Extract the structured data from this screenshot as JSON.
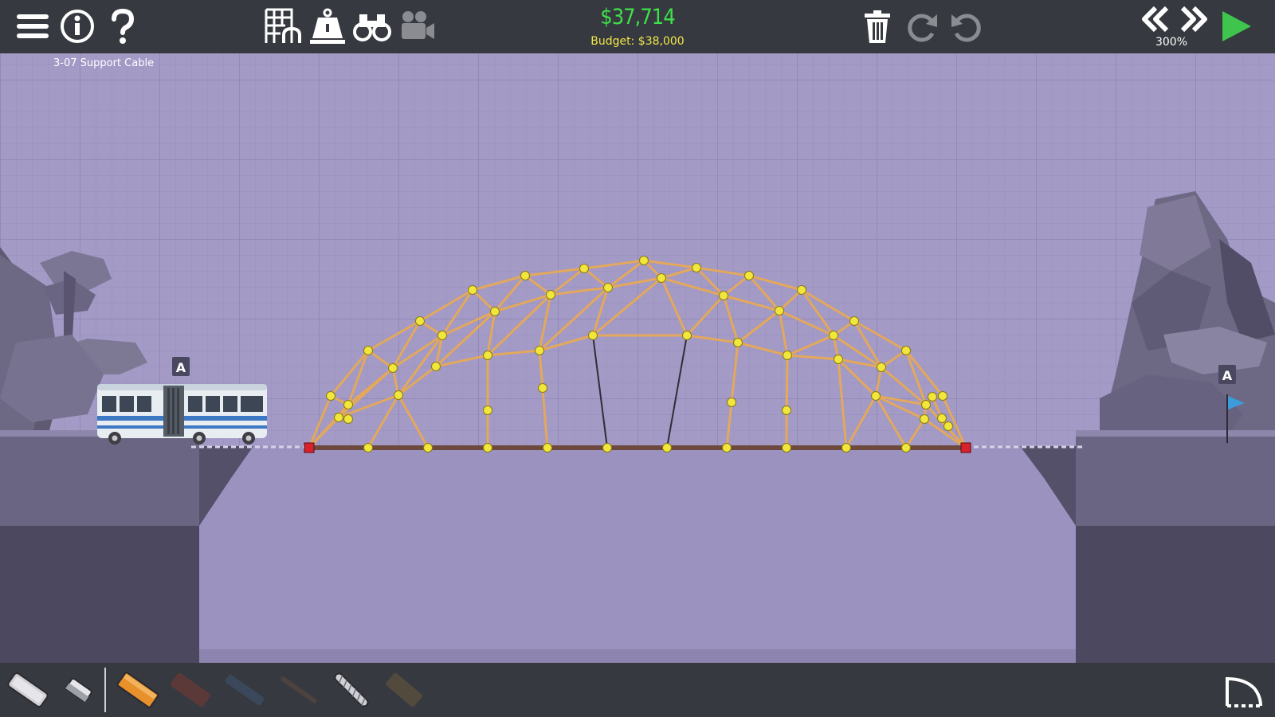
{
  "level": {
    "name": "3-07 Support Cable"
  },
  "cost": {
    "current": "$37,714",
    "budget": "Budget: $38,000"
  },
  "simulation": {
    "speed": "300%"
  },
  "toolbar": {
    "left": [
      "menu-icon",
      "info-icon",
      "help-icon"
    ],
    "center": [
      "grid-icon",
      "weight-icon",
      "binoculars-icon",
      "camera-icon"
    ],
    "right": [
      "trash-icon",
      "redo-icon",
      "undo-icon",
      "rewind-icon",
      "fast-forward-icon",
      "play-icon"
    ]
  },
  "checkpoints": {
    "start_label": "A",
    "end_label": "A"
  },
  "materials": [
    {
      "name": "road",
      "state": "available"
    },
    {
      "name": "eraser",
      "state": "available"
    },
    {
      "name": "wood",
      "state": "selected"
    },
    {
      "name": "reinforced-road",
      "state": "locked"
    },
    {
      "name": "steel",
      "state": "locked"
    },
    {
      "name": "rope",
      "state": "locked"
    },
    {
      "name": "cable",
      "state": "available"
    },
    {
      "name": "spring",
      "state": "locked"
    }
  ],
  "colors": {
    "background": "#a39ac6",
    "toolbar": "#36393f",
    "cost_green": "#3fe04a",
    "budget_yellow": "#f1e64a",
    "wood_beam": "#e3a85c",
    "road": "#6e4a3e",
    "joint": "#f1e63b",
    "anchor": "#d8222c",
    "cable": "#2e2e35"
  },
  "vehicle": {
    "type": "bus"
  }
}
